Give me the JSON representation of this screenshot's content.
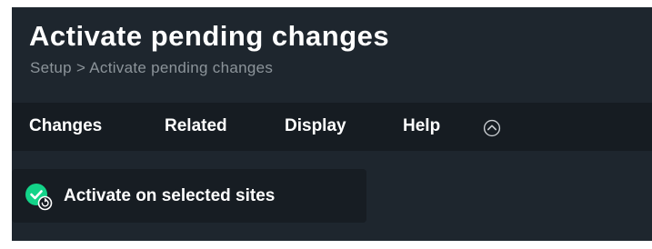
{
  "page": {
    "title": "Activate pending changes",
    "breadcrumb": "Setup > Activate pending changes"
  },
  "menu": {
    "items": [
      {
        "label": "Changes"
      },
      {
        "label": "Related"
      },
      {
        "label": "Display"
      },
      {
        "label": "Help"
      }
    ],
    "toggle_icon": "chevron-up-circle-icon"
  },
  "actions": {
    "activate_label": "Activate on selected sites",
    "activate_icon": "check-circle-icon",
    "activate_icon_badge": "reload-icon"
  },
  "colors": {
    "background": "#1e262e",
    "menubar": "#161c22",
    "button_background": "#171d23",
    "text": "#ffffff",
    "breadcrumb_text": "#8c949a",
    "check_green": "#13d389"
  }
}
